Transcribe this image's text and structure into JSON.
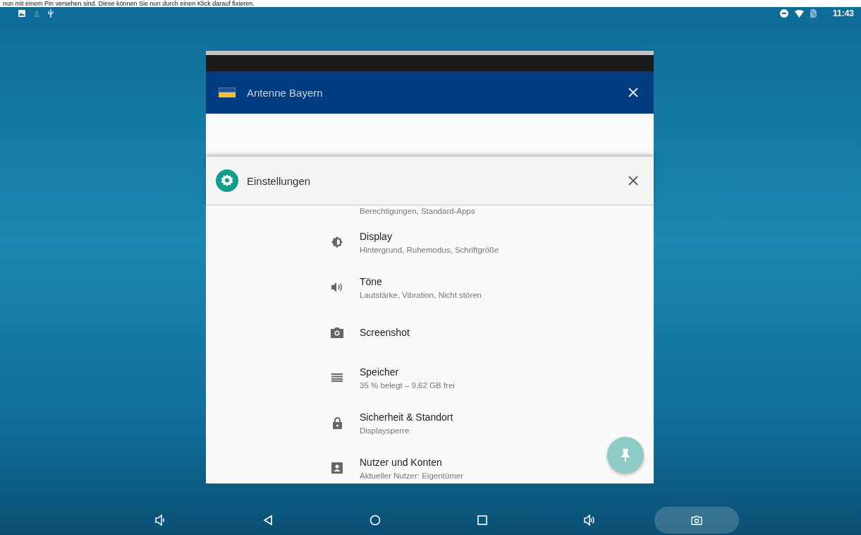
{
  "caption": "nun mit einem Pin versehen sind. Diese können Sie nun durch einen Klick darauf fixieren.",
  "status_bar": {
    "time": "11:43"
  },
  "recent_apps": [
    {
      "kind": "radio",
      "title": "Antenne Bayern"
    },
    {
      "kind": "settings",
      "title": "Einstellungen"
    }
  ],
  "settings_list": [
    {
      "kind": "partial",
      "subtitle": "Berechtigungen, Standard-Apps"
    },
    {
      "kind": "display",
      "title": "Display",
      "subtitle": "Hintergrund, Ruhemodus, Schriftgröße"
    },
    {
      "kind": "sound",
      "title": "Töne",
      "subtitle": "Lautstärke, Vibration, Nicht stören"
    },
    {
      "kind": "camera",
      "title": "Screenshot"
    },
    {
      "kind": "storage",
      "title": "Speicher",
      "subtitle": "35 % belegt – 9,62 GB frei"
    },
    {
      "kind": "lock",
      "title": "Sicherheit & Standort",
      "subtitle": "Displaysperre"
    },
    {
      "kind": "account",
      "title": "Nutzer und Konten",
      "subtitle": "Aktueller Nutzer: Eigentümer"
    }
  ],
  "nav_bar": [
    {
      "kind": "volume_down"
    },
    {
      "kind": "back"
    },
    {
      "kind": "home"
    },
    {
      "kind": "recents"
    },
    {
      "kind": "volume_up"
    },
    {
      "kind": "screenshot"
    }
  ]
}
